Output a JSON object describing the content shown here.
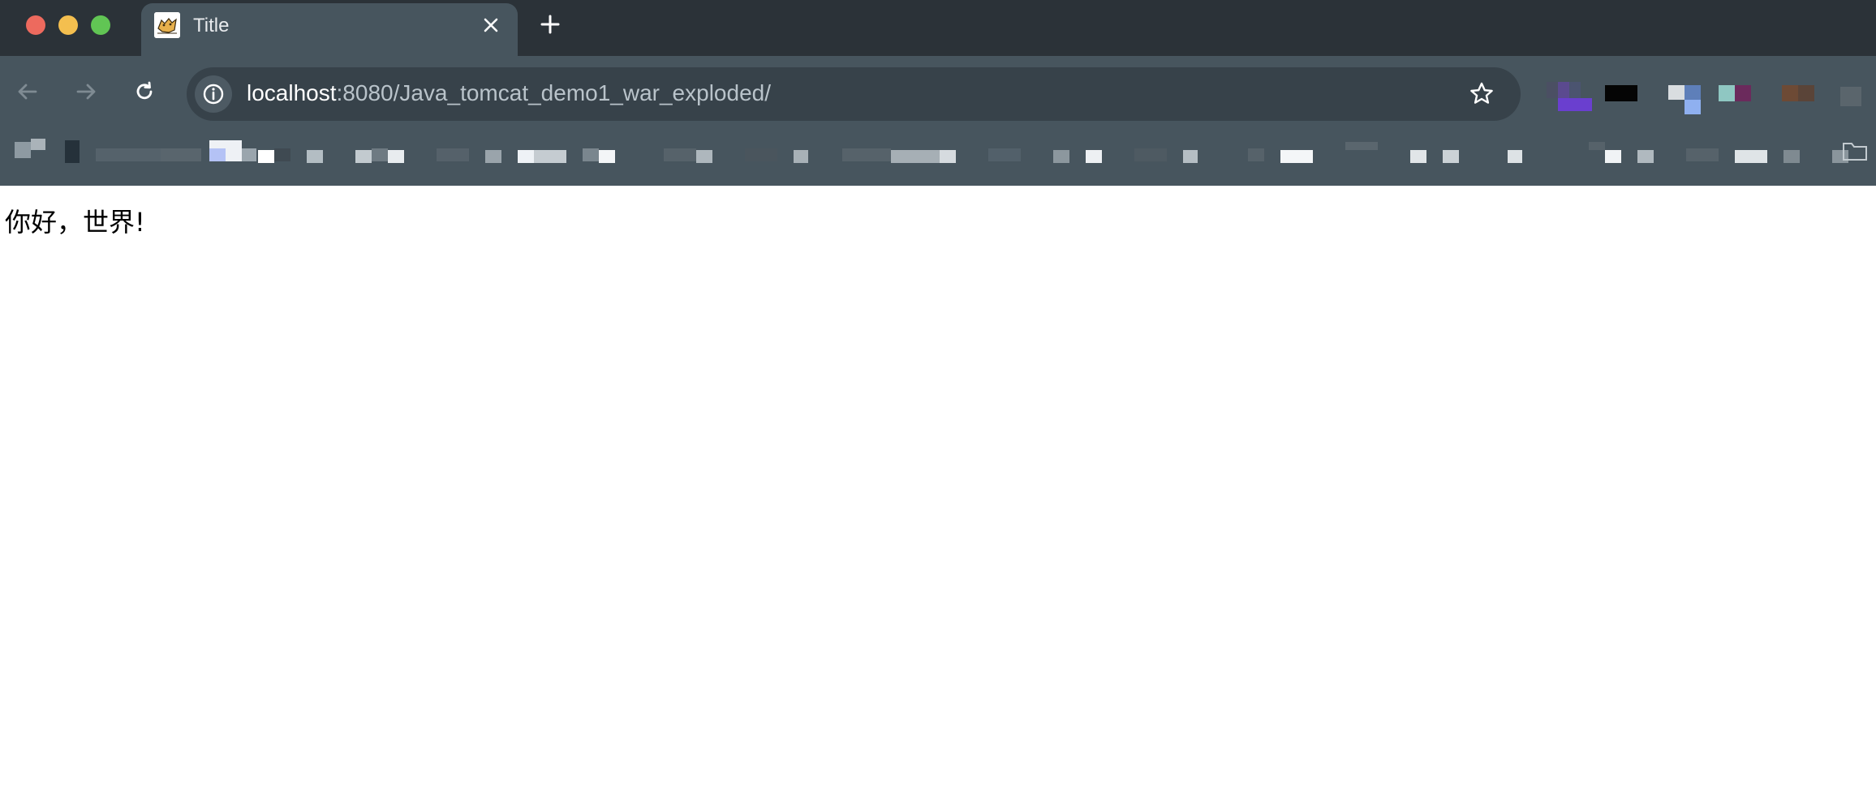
{
  "window": {
    "controls": [
      "close",
      "minimize",
      "maximize"
    ]
  },
  "tab": {
    "title": "Title",
    "favicon": "tomcat-icon"
  },
  "toolbar": {
    "url_host": "localhost",
    "url_path": ":8080/Java_tomcat_demo1_war_exploded/",
    "icons": [
      "back-arrow-icon",
      "forward-arrow-icon",
      "reload-icon",
      "info-icon",
      "star-icon"
    ]
  },
  "page": {
    "greeting": "你好，世界!"
  },
  "colors": {
    "tabstrip": "#2b3238",
    "toolbar": "#47555e",
    "omnibox": "#37424a",
    "close": "#ed6a5e",
    "minimize": "#f4bf4f",
    "maximize": "#61c554"
  }
}
